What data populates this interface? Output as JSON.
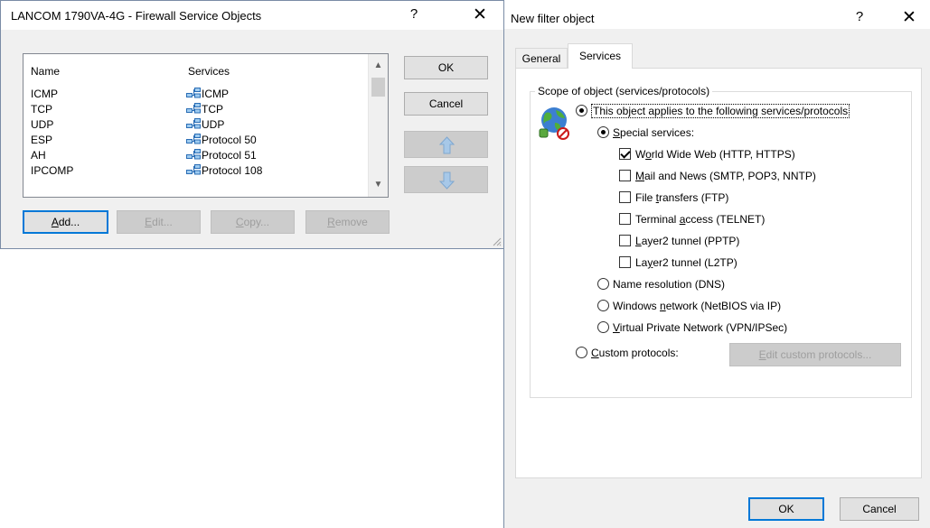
{
  "firewall_dialog": {
    "title": "LANCOM 1790VA-4G - Firewall Service Objects",
    "help_glyph": "?",
    "close_glyph": "✕",
    "columns": [
      "Name",
      "Services"
    ],
    "rows": [
      {
        "name": "ICMP",
        "service": "ICMP"
      },
      {
        "name": "TCP",
        "service": "TCP"
      },
      {
        "name": "UDP",
        "service": "UDP"
      },
      {
        "name": "ESP",
        "service": "Protocol 50"
      },
      {
        "name": "AH",
        "service": "Protocol 51"
      },
      {
        "name": "IPCOMP",
        "service": "Protocol 108"
      }
    ],
    "buttons": {
      "ok": "OK",
      "cancel": "Cancel",
      "add_u": "A",
      "add_rest": "dd...",
      "edit_u": "E",
      "edit_rest": "dit...",
      "copy_u": "C",
      "copy_rest": "opy...",
      "remove_u": "R",
      "remove_rest": "emove"
    }
  },
  "filter_dialog": {
    "title": "New filter object",
    "help_glyph": "?",
    "close_glyph": "✕",
    "tabs": {
      "general": "General",
      "services": "Services"
    },
    "group_title": "Scope of object (services/protocols)",
    "applies_label": "This object applies to the following services/protocols",
    "special_u": "S",
    "special_rest": "pecial services:",
    "checkboxes": [
      {
        "pre": "W",
        "u": "o",
        "post": "rld Wide Web (HTTP, HTTPS)",
        "checked": true
      },
      {
        "pre": "",
        "u": "M",
        "post": "ail and News (SMTP, POP3, NNTP)",
        "checked": false
      },
      {
        "pre": "File ",
        "u": "t",
        "post": "ransfers (FTP)",
        "checked": false
      },
      {
        "pre": "Terminal ",
        "u": "a",
        "post": "ccess (TELNET)",
        "checked": false
      },
      {
        "pre": "",
        "u": "L",
        "post": "ayer2 tunnel (PPTP)",
        "checked": false
      },
      {
        "pre": "La",
        "u": "y",
        "post": "er2 tunnel (L2TP)",
        "checked": false
      }
    ],
    "radios": [
      {
        "pre": "Name resolution (DNS)",
        "u": "",
        "post": ""
      },
      {
        "pre": "Windows ",
        "u": "n",
        "post": "etwork (NetBIOS via IP)"
      },
      {
        "pre": "",
        "u": "V",
        "post": "irtual Private Network (VPN/IPSec)"
      }
    ],
    "custom_u": "C",
    "custom_rest": "ustom protocols:",
    "edit_custom_u": "E",
    "edit_custom_rest": "dit custom protocols...",
    "ok": "OK",
    "cancel": "Cancel"
  }
}
